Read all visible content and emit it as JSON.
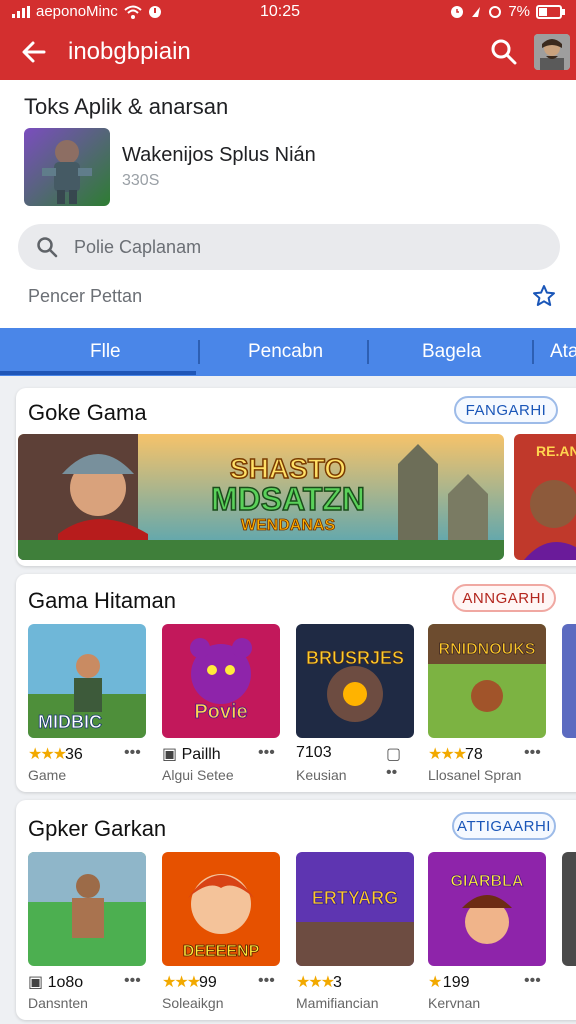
{
  "status": {
    "carrier": "aeponoMinc",
    "time": "10:25",
    "battery_text": "7%"
  },
  "appbar": {
    "title": "inobgbpiain"
  },
  "header": {
    "heading": "Toks Aplik & anarsan",
    "app_name": "Wakenijos Splus Nián",
    "app_sub": "330S",
    "search_placeholder": "Polie Caplanam",
    "filter_label": "Pencer Pettan"
  },
  "tabs": [
    "Flle",
    "Pencabn",
    "Bagela",
    "Ata"
  ],
  "section1": {
    "title": "Goke Gama",
    "button": "FANGARHI",
    "banner_line1": "SHASTO",
    "banner_line2": "MDSATZN",
    "banner_line3": "WENDANAS",
    "peek_label": "RE.AN"
  },
  "section2": {
    "title": "Gama Hitaman",
    "button": "ANNGARHI",
    "items": [
      {
        "thumb": "MIDBIC",
        "rating": "36",
        "rating_glyph": "stars",
        "genre": "Game"
      },
      {
        "thumb": "Povie",
        "rating": "Paillh",
        "rating_glyph": "icon",
        "genre": "Algui Setee"
      },
      {
        "thumb": "BRUSRJES",
        "rating": "7103",
        "rating_glyph": "none",
        "genre": "Keusian"
      },
      {
        "thumb": "RNIDNOUKS",
        "rating": "78",
        "rating_glyph": "stars",
        "genre": "Llosanel Spran"
      }
    ]
  },
  "section3": {
    "title": "Gpker Garkan",
    "button": "ATTIGAARHI",
    "items": [
      {
        "thumb": "",
        "rating": "1o8o",
        "rating_glyph": "icon",
        "genre": "Dansnten"
      },
      {
        "thumb": "DEEEENP",
        "rating": "99",
        "rating_glyph": "stars",
        "genre": "Soleaikgn"
      },
      {
        "thumb": "ERTYARG",
        "rating": "3",
        "rating_glyph": "stars",
        "genre": "Mamifiancian"
      },
      {
        "thumb": "GIARBLA",
        "rating": "199",
        "rating_glyph": "star1",
        "genre": "Kervnan"
      }
    ]
  },
  "colors": {
    "brand_red": "#d32f2f",
    "tab_blue": "#4a86e8",
    "star_gold": "#f2a900"
  }
}
